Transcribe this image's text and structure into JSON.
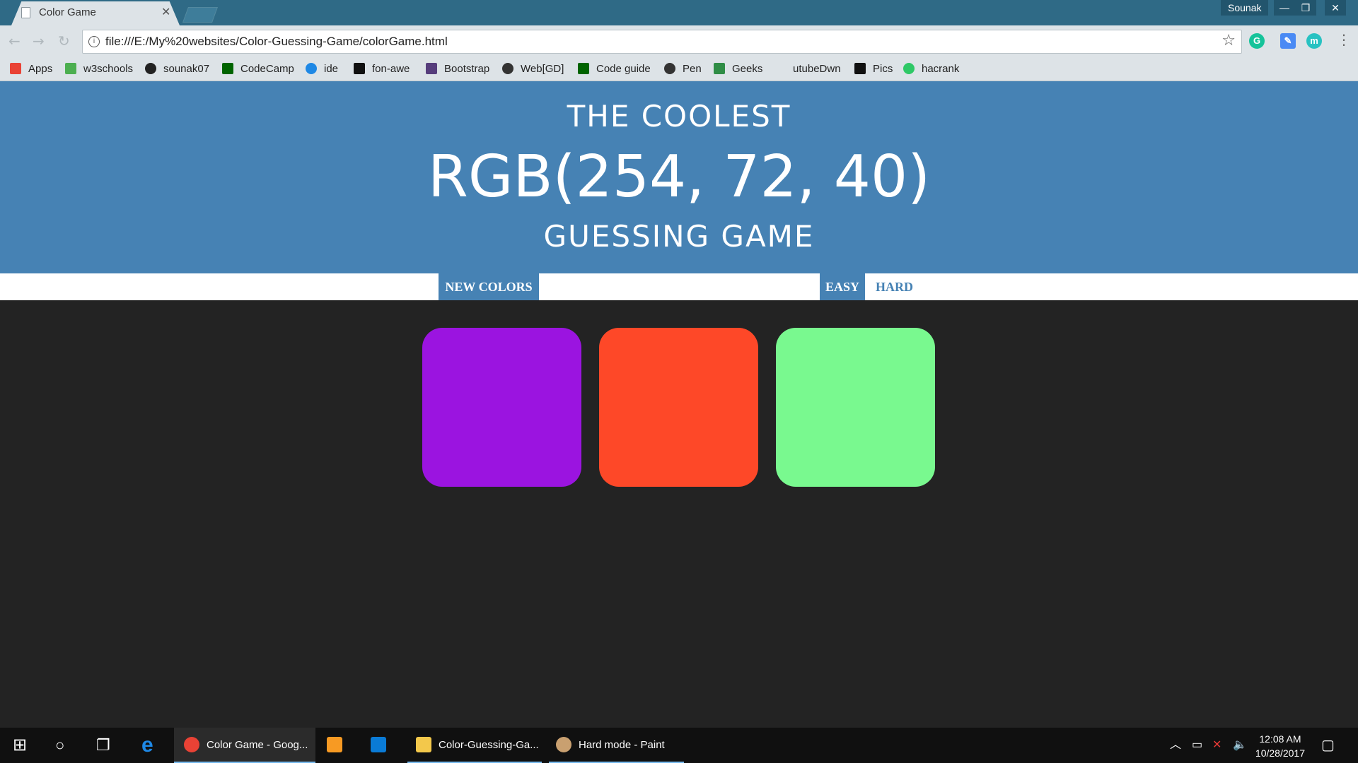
{
  "browser": {
    "tab_title": "Color Game",
    "profile_name": "Sounak",
    "url": "file:///E:/My%20websites/Color-Guessing-Game/colorGame.html",
    "bookmarks": [
      {
        "label": "Apps",
        "icon": "apps-grid-icon",
        "color": "#e94235"
      },
      {
        "label": "w3schools",
        "icon": "w3schools-icon",
        "color": "#4caf50"
      },
      {
        "label": "sounak07",
        "icon": "github-icon",
        "color": "#222222"
      },
      {
        "label": "CodeCamp",
        "icon": "codecamp-icon",
        "color": "#006400"
      },
      {
        "label": "ide",
        "icon": "cloud-icon",
        "color": "#1e88e5"
      },
      {
        "label": "fon-awe",
        "icon": "flag-icon",
        "color": "#111111"
      },
      {
        "label": "Bootstrap",
        "icon": "bootstrap-icon",
        "color": "#563d7c"
      },
      {
        "label": "Web[GD]",
        "icon": "web-icon",
        "color": "#333333"
      },
      {
        "label": "Code guide",
        "icon": "codeguide-icon",
        "color": "#006400"
      },
      {
        "label": "Pen",
        "icon": "codepen-icon",
        "color": "#333333"
      },
      {
        "label": "Geeks",
        "icon": "geeks-icon",
        "color": "#2f8d46"
      },
      {
        "label": "utubeDwn",
        "icon": "blank-icon",
        "color": "#dde3e7"
      },
      {
        "label": "Pics",
        "icon": "camera-icon",
        "color": "#111111"
      },
      {
        "label": "hacrank",
        "icon": "hackerrank-icon",
        "color": "#2ec866"
      }
    ]
  },
  "game": {
    "title_top": "The Coolest",
    "rgb_display": "RGB(254, 72, 40)",
    "title_bottom": "Guessing Game",
    "new_colors_label": "New Colors",
    "easy_label": "Easy",
    "hard_label": "Hard",
    "selected_mode": "easy",
    "squares": [
      "#9b14e0",
      "#fe4828",
      "#79f98f"
    ],
    "header_color": "#4682b4",
    "background_color": "#232323"
  },
  "taskbar": {
    "items": [
      {
        "label": "Color Game - Goog...",
        "icon": "chrome-icon"
      },
      {
        "label": "",
        "icon": "sublime-icon"
      },
      {
        "label": "",
        "icon": "app-icon"
      },
      {
        "label": "Color-Guessing-Ga...",
        "icon": "folder-icon"
      },
      {
        "label": "Hard mode - Paint",
        "icon": "paint-icon"
      }
    ],
    "time": "12:08 AM",
    "date": "10/28/2017"
  }
}
